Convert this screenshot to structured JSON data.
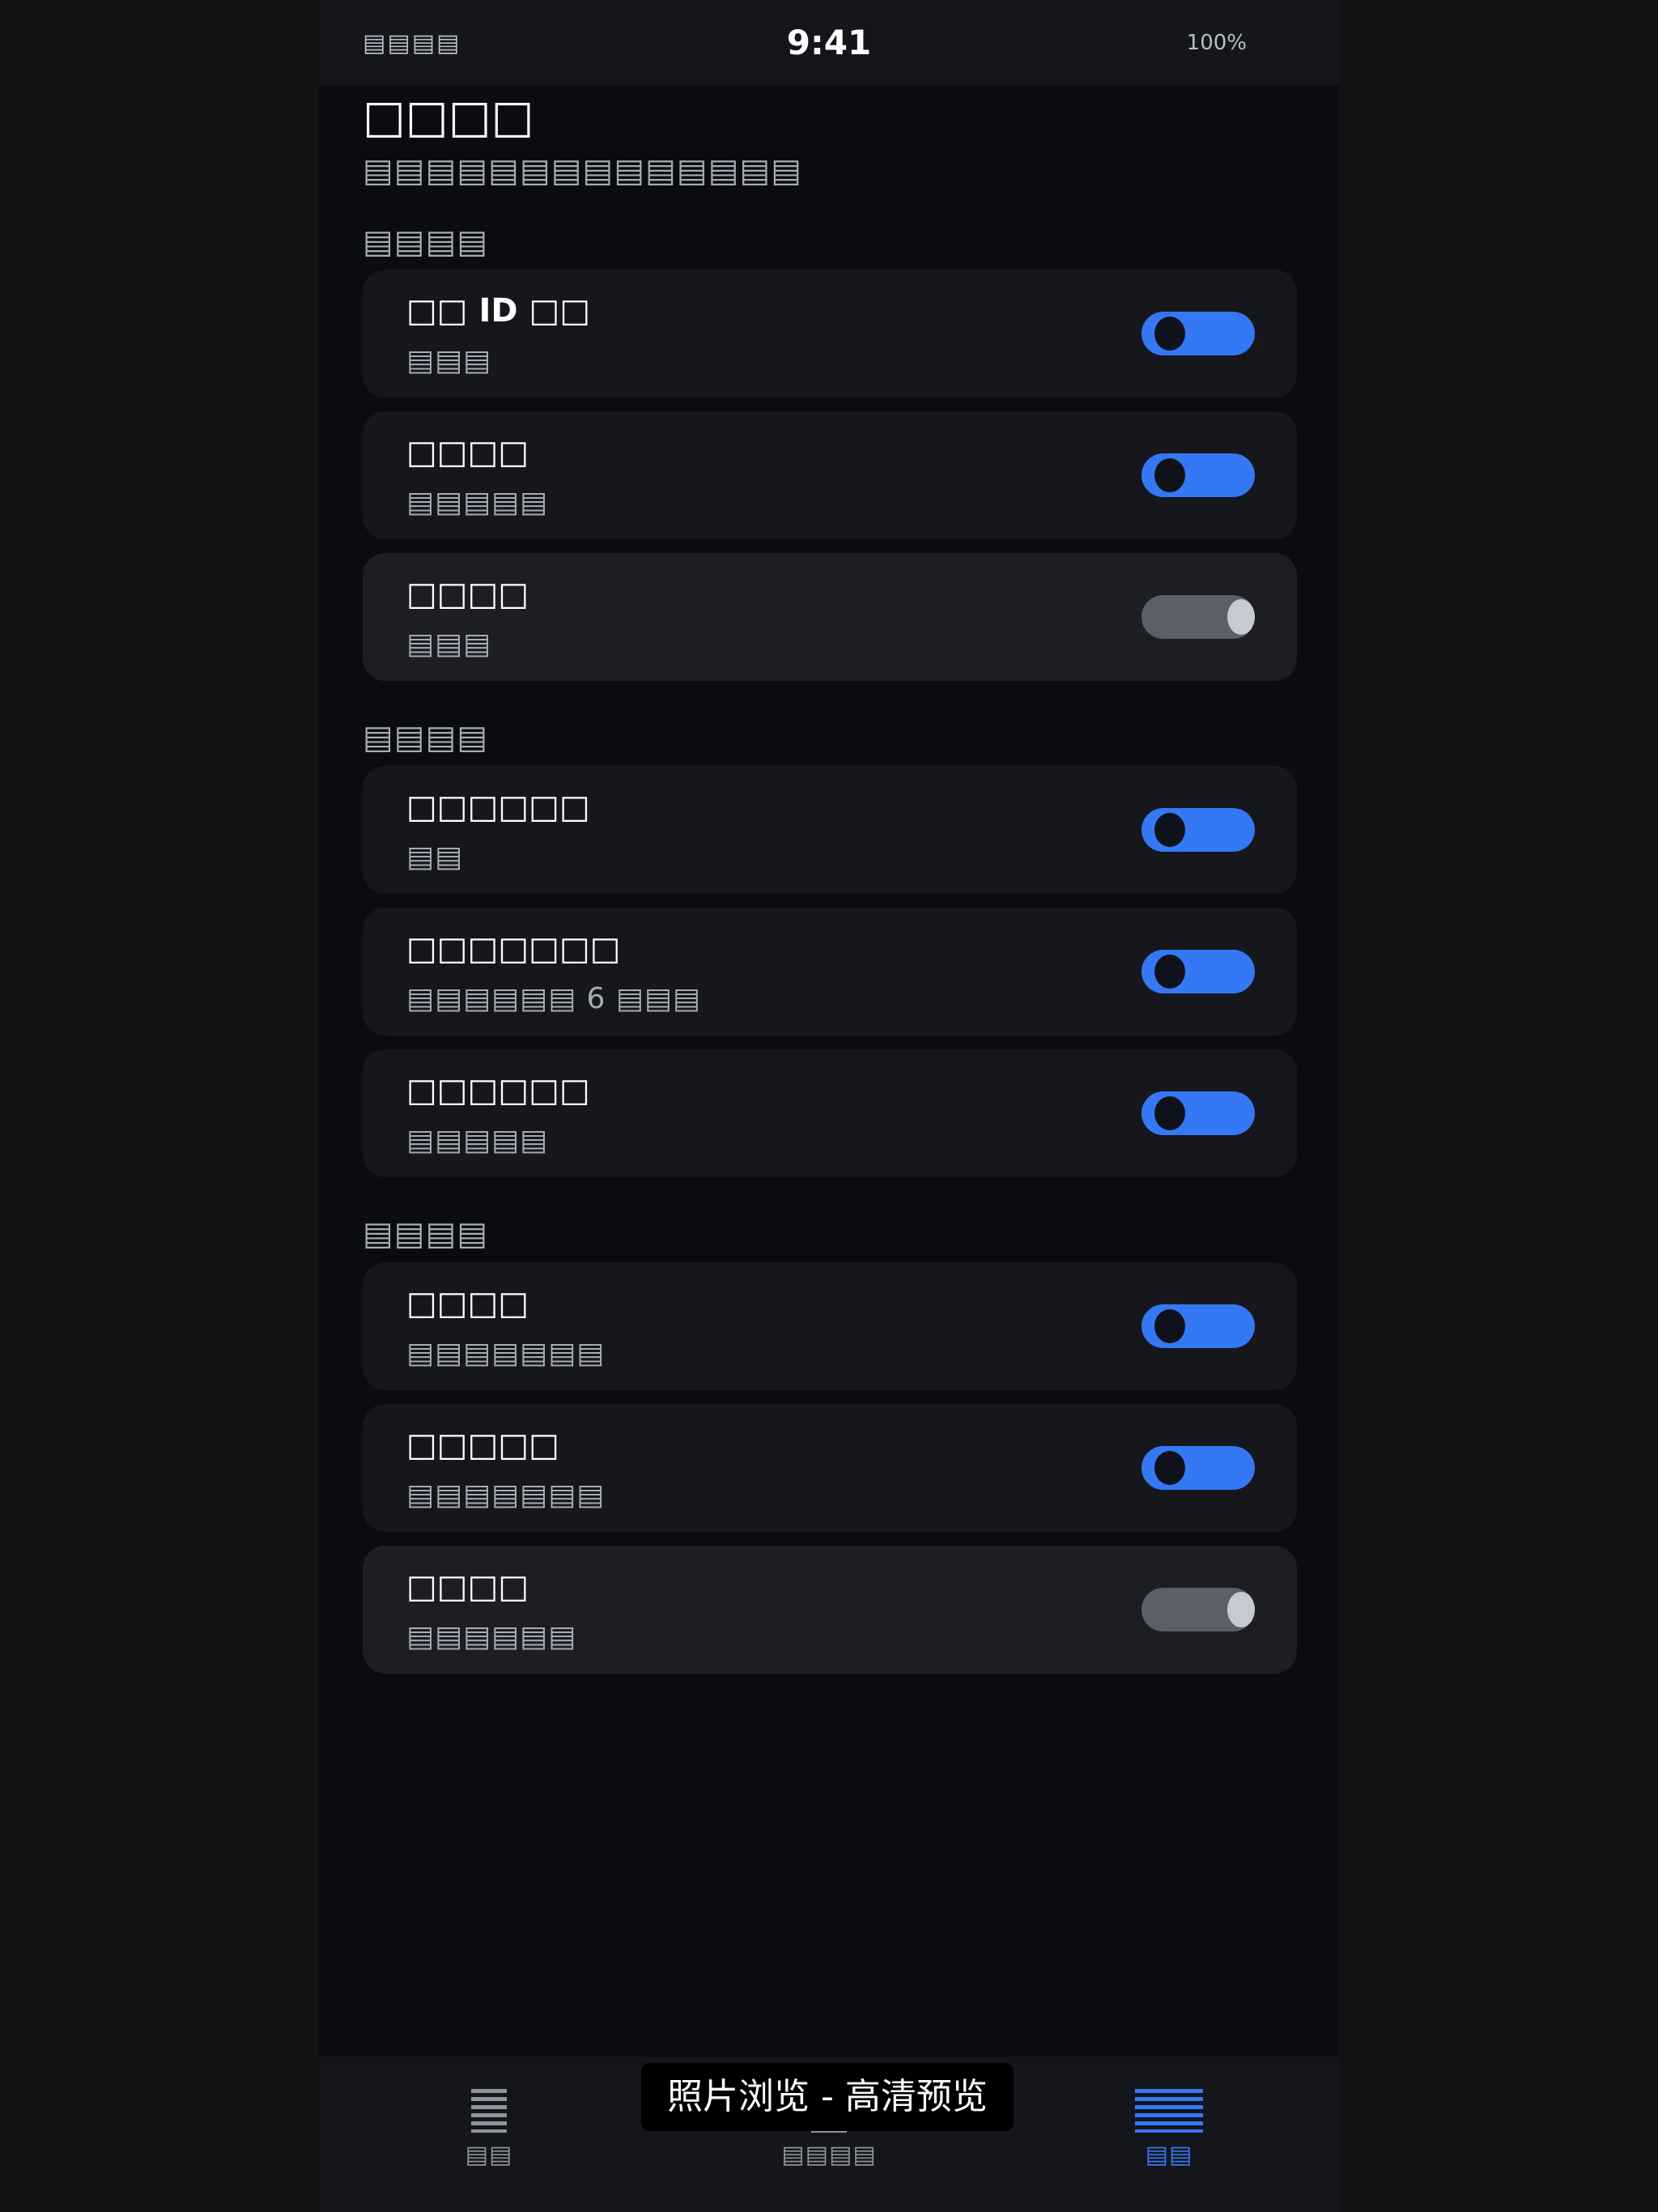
{
  "status_bar": {
    "carrier": "▤▤▤▤",
    "time": "9:41",
    "battery": "100%"
  },
  "header": {
    "title": "□□□□",
    "subtitle": "▤▤▤▤▤▤▤▤▤▤▤▤▤▤"
  },
  "sections": [
    {
      "label": "▤▤▤▤",
      "items": [
        {
          "title": "□□ ID □□",
          "desc": "▤▤▤",
          "on": true
        },
        {
          "title": "□□□□",
          "desc": "▤▤▤▤▤",
          "on": true
        },
        {
          "title": "□□□□",
          "desc": "▤▤▤",
          "on": false
        }
      ]
    },
    {
      "label": "▤▤▤▤",
      "items": [
        {
          "title": "□□□□□□",
          "desc": "▤▤",
          "on": true
        },
        {
          "title": "□□□□□□□",
          "desc": "▤▤▤▤▤▤ 6 ▤▤▤",
          "on": true
        },
        {
          "title": "□□□□□□",
          "desc": "▤▤▤▤▤",
          "on": true
        }
      ]
    },
    {
      "label": "▤▤▤▤",
      "items": [
        {
          "title": "□□□□",
          "desc": "▤▤▤▤▤▤▤",
          "on": true
        },
        {
          "title": "□□□□□",
          "desc": "▤▤▤▤▤▤▤",
          "on": true
        },
        {
          "title": "□□□□",
          "desc": "▤▤▤▤▤▤",
          "on": false
        }
      ]
    }
  ],
  "tab_bar": {
    "tabs": [
      {
        "label": "▤▤",
        "icon": "list-icon",
        "active": false
      },
      {
        "label": "▤▤▤▤",
        "icon": "grid-icon",
        "active": false
      },
      {
        "label": "▤▤",
        "icon": "settings-icon",
        "active": true
      }
    ]
  },
  "toast": {
    "text": "照片浏览 - 高清预览"
  },
  "colors": {
    "accent": "#3478f6",
    "background": "#0b0c10",
    "card": "#16171c",
    "toggle_off": "#5b5f69"
  }
}
